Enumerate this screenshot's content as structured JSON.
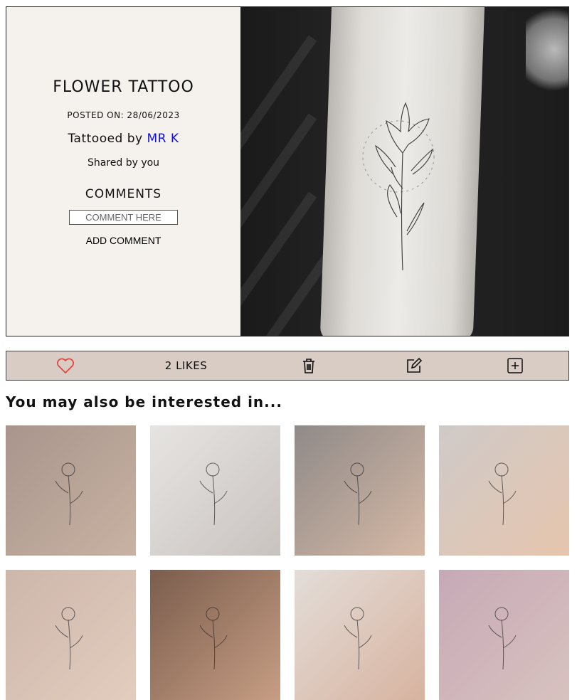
{
  "post": {
    "title": "FLOWER TATTOO",
    "posted_label": "POSTED ON: 28/06/2023",
    "tattooed_prefix": "Tattooed by ",
    "artist": "MR K",
    "shared": "Shared by you",
    "comments_heading": "COMMENTS",
    "comment_placeholder": "COMMENT HERE",
    "add_comment_label": "ADD COMMENT"
  },
  "toolbar": {
    "likes_label": "2 LIKES",
    "icons": [
      "heart-icon",
      "trash-icon",
      "edit-icon",
      "add-square-icon"
    ]
  },
  "recommendations": {
    "heading": "You may also be interested in...",
    "thumbnails": [
      {
        "bg1": "#a9958c",
        "bg2": "#c8b2a3"
      },
      {
        "bg1": "#e6e4e2",
        "bg2": "#c9c3bf"
      },
      {
        "bg1": "#8f8a88",
        "bg2": "#d6b9a6"
      },
      {
        "bg1": "#cfcac8",
        "bg2": "#e6c5ad"
      },
      {
        "bg1": "#cdb6aa",
        "bg2": "#e2cdbf"
      },
      {
        "bg1": "#7a5d4c",
        "bg2": "#c79d84"
      },
      {
        "bg1": "#e3ddd8",
        "bg2": "#d8b3a0"
      },
      {
        "bg1": "#c6a9b6",
        "bg2": "#d8c2bf"
      }
    ]
  },
  "colors": {
    "toolbar_bg": "#d9ccc4",
    "info_bg": "#f5f1ed",
    "artist_link": "#1010e0",
    "heart": "#e2473f"
  }
}
